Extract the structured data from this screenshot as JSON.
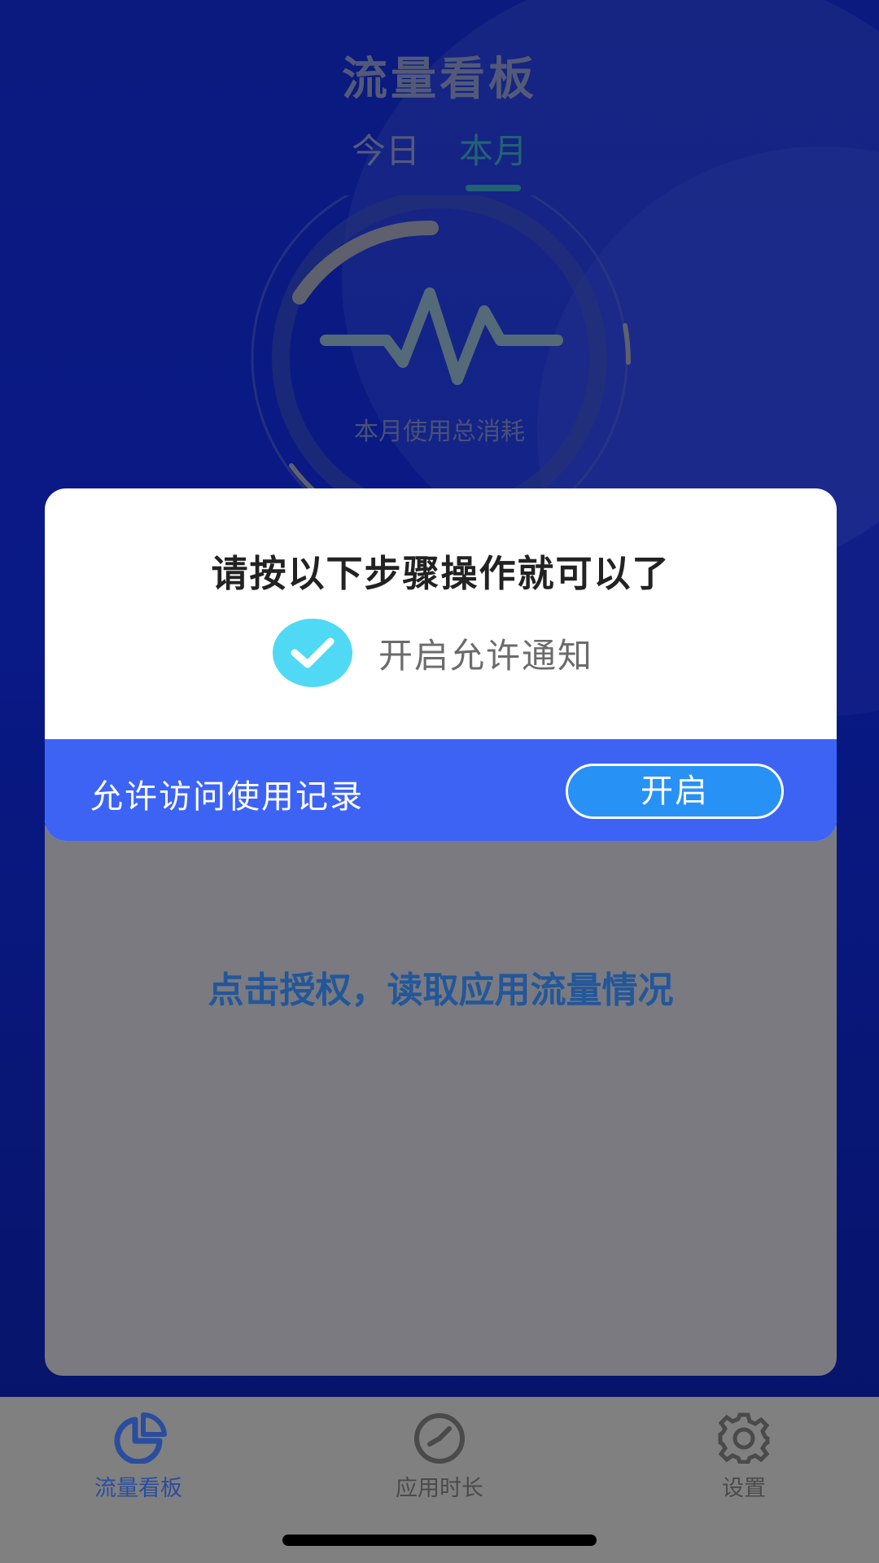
{
  "header": {
    "title": "流量看板"
  },
  "tabs": [
    {
      "label": "今日",
      "active": false
    },
    {
      "label": "本月",
      "active": true
    }
  ],
  "gauge": {
    "label": "本月使用总消耗",
    "icon": "pulse-icon"
  },
  "dialog": {
    "title": "请按以下步骤操作就可以了",
    "step_done": {
      "text": "开启允许通知",
      "icon": "check-circle-icon"
    },
    "step_pending": {
      "text": "允许访问使用记录",
      "button_label": "开启"
    }
  },
  "panel": {
    "link_text": "点击授权，读取应用流量情况"
  },
  "bottom_nav": [
    {
      "label": "流量看板",
      "icon": "pie-chart-icon",
      "active": true
    },
    {
      "label": "应用时长",
      "icon": "clock-icon",
      "active": false
    },
    {
      "label": "设置",
      "icon": "gear-icon",
      "active": false
    }
  ],
  "colors": {
    "background": "#0d1f9c",
    "accent_teal": "#2b7f8c",
    "dialog_bar": "#3d63f5",
    "button": "#2891f5",
    "check": "#4fd9f5",
    "nav_active": "#2a4d9e"
  }
}
